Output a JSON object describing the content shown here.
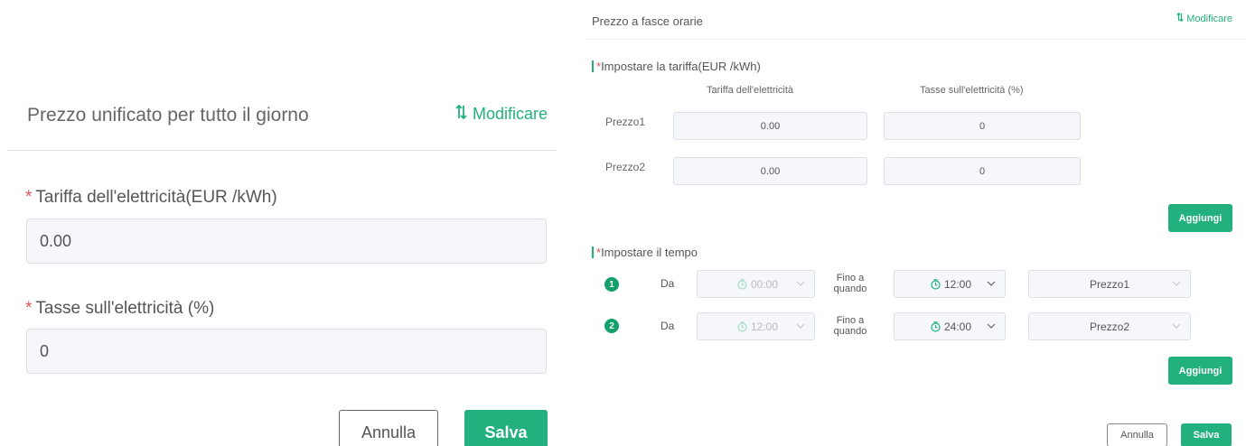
{
  "colors": {
    "accent": "#22b07d",
    "required": "#e05656",
    "field_bg": "#f5f7fa",
    "border": "#dcdfe6"
  },
  "unified": {
    "title": "Prezzo unificato per tutto il giorno",
    "modify_label": "Modificare",
    "modify_icon": "sort-arrows-icon",
    "tariff_label": "Tariffa dell'elettricità(EUR /kWh)",
    "tariff_value": "0.00",
    "tax_label": "Tasse sull'elettricità (%)",
    "tax_value": "0",
    "cancel_label": "Annulla",
    "save_label": "Salva"
  },
  "timeband": {
    "title": "Prezzo a fasce orarie",
    "modify_label": "Modificare",
    "tariff_section": "Impostare la tariffa(EUR /kWh)",
    "col_tariff": "Tariffa dell'elettricità",
    "col_tax": "Tasse sull'elettricità (%)",
    "prices": [
      {
        "name": "Prezzo1",
        "tariff": "0.00",
        "tax": "0"
      },
      {
        "name": "Prezzo2",
        "tariff": "0.00",
        "tax": "0"
      }
    ],
    "add_label": "Aggiungi",
    "time_section": "Impostare il tempo",
    "from_label": "Da",
    "until_label": "Fino a quando",
    "slots": [
      {
        "index": "1",
        "from": "00:00",
        "to": "12:00",
        "price": "Prezzo1"
      },
      {
        "index": "2",
        "from": "12:00",
        "to": "24:00",
        "price": "Prezzo2"
      }
    ],
    "cancel_label": "Annulla",
    "save_label": "Salva"
  }
}
